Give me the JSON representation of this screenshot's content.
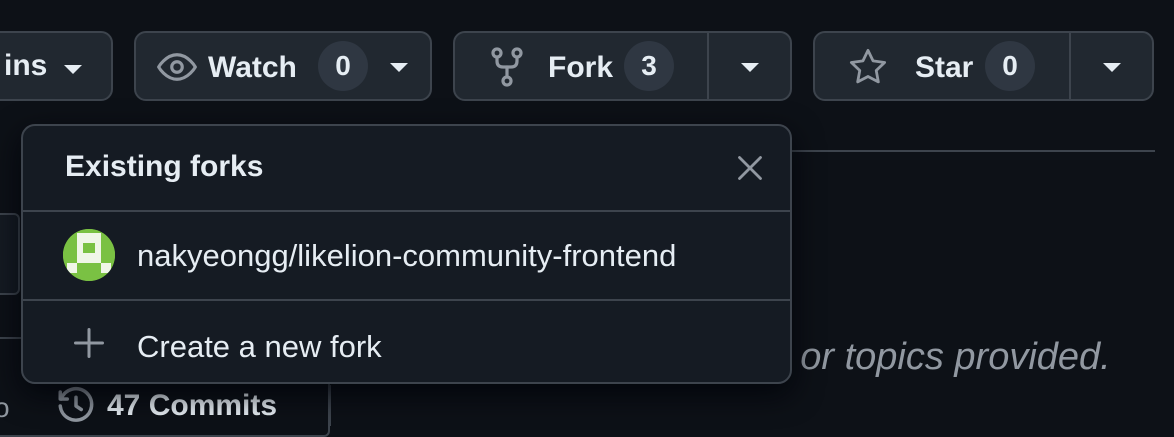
{
  "toolbar": {
    "plugins_label": "ins",
    "watch": {
      "label": "Watch",
      "count": "0"
    },
    "fork": {
      "label": "Fork",
      "count": "3"
    },
    "star": {
      "label": "Star",
      "count": "0"
    }
  },
  "popup": {
    "title": "Existing forks",
    "forks": [
      {
        "name": "nakyeongg/likelion-community-frontend"
      }
    ],
    "create_label": "Create a new fork"
  },
  "repo": {
    "description_fragment": "e, or topics provided.",
    "commits_label": "47 Commits",
    "left_fragment": "o"
  },
  "colors": {
    "background": "#0d1117",
    "button_bg": "#212830",
    "border": "#3d444d",
    "avatar_green": "#7ac143"
  },
  "icons": {
    "watch": "eye-icon",
    "fork": "repo-forked-icon",
    "star": "star-icon",
    "close": "x-icon",
    "create": "plus-icon",
    "history": "history-icon"
  }
}
